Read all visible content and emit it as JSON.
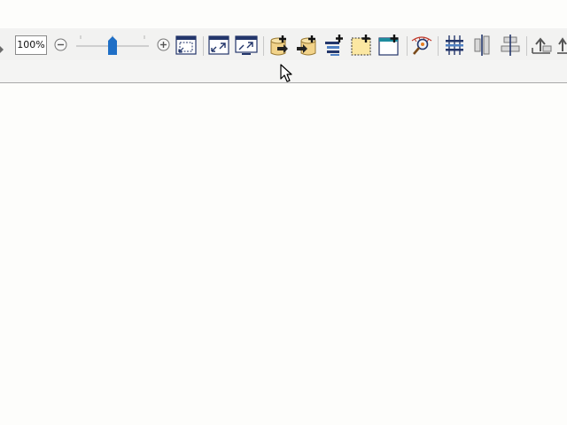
{
  "toolbar": {
    "zoom_value": "100%",
    "zoom_slider_level": 0.5,
    "buttons": [
      "zoom-out-icon",
      "zoom-in-icon",
      "fit-page-icon",
      "expand-icon",
      "fullscreen-icon",
      "add-table-left-icon",
      "add-table-right-icon",
      "add-row-icon",
      "add-note-icon",
      "add-window-icon",
      "magnifier-inspect-icon",
      "distribute-columns-icon",
      "align-vertical-icon",
      "align-horizontal-icon",
      "move-up-icon",
      "move-up-2-icon"
    ]
  },
  "colors": {
    "accent": "#1f6fc6",
    "icon_navy": "#23366b",
    "icon_tan": "#f2d38a",
    "background": "#fdfdfb"
  }
}
